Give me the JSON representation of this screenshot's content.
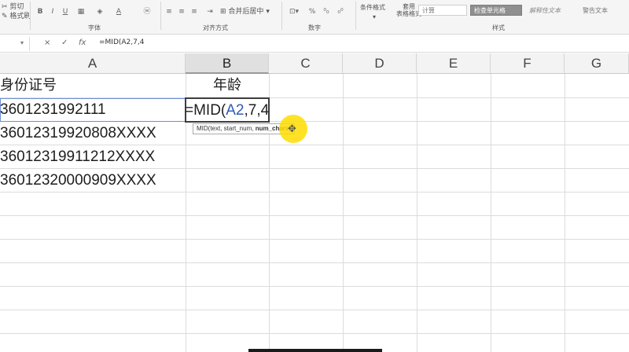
{
  "ribbon": {
    "clipboard": {
      "cut": "剪切",
      "format_painter": "格式刷"
    },
    "font": {
      "label": "字体",
      "bold": "B",
      "italic": "I",
      "underline": "U"
    },
    "alignment": {
      "label": "对齐方式",
      "merge": "合并后居中"
    },
    "number": {
      "label": "数字",
      "percent": "%"
    },
    "styles": {
      "label": "样式",
      "conditional_format": "条件格式",
      "table_format_1": "套用",
      "table_format_2": "表格格式",
      "style_calc": "计算",
      "style_check": "检查单元格",
      "style_explain": "解释性文本",
      "style_warning": "警告文本"
    }
  },
  "formula_bar": {
    "cancel": "×",
    "confirm": "✓",
    "fx": "fx",
    "formula": "=MID(A2,7,4"
  },
  "columns": [
    "A",
    "B",
    "C",
    "D",
    "E",
    "F",
    "G"
  ],
  "selected_column": "B",
  "cells": {
    "a1": "身份证号",
    "b1": "年龄",
    "a2": "3601231992111",
    "a3": "36012319920808XXXX",
    "a4": "36012319911212XXXX",
    "a5": "36012320000909XXXX"
  },
  "editing": {
    "prefix": "=MID(",
    "ref": "A2",
    "suffix": ",7,4"
  },
  "tooltip": {
    "signature": "MID(text, start_num, ",
    "current_arg": "num_chars",
    "close": ")"
  },
  "colors": {
    "accent_ref": "#2f5bb7",
    "cursor_highlight": "#ffdd00"
  }
}
